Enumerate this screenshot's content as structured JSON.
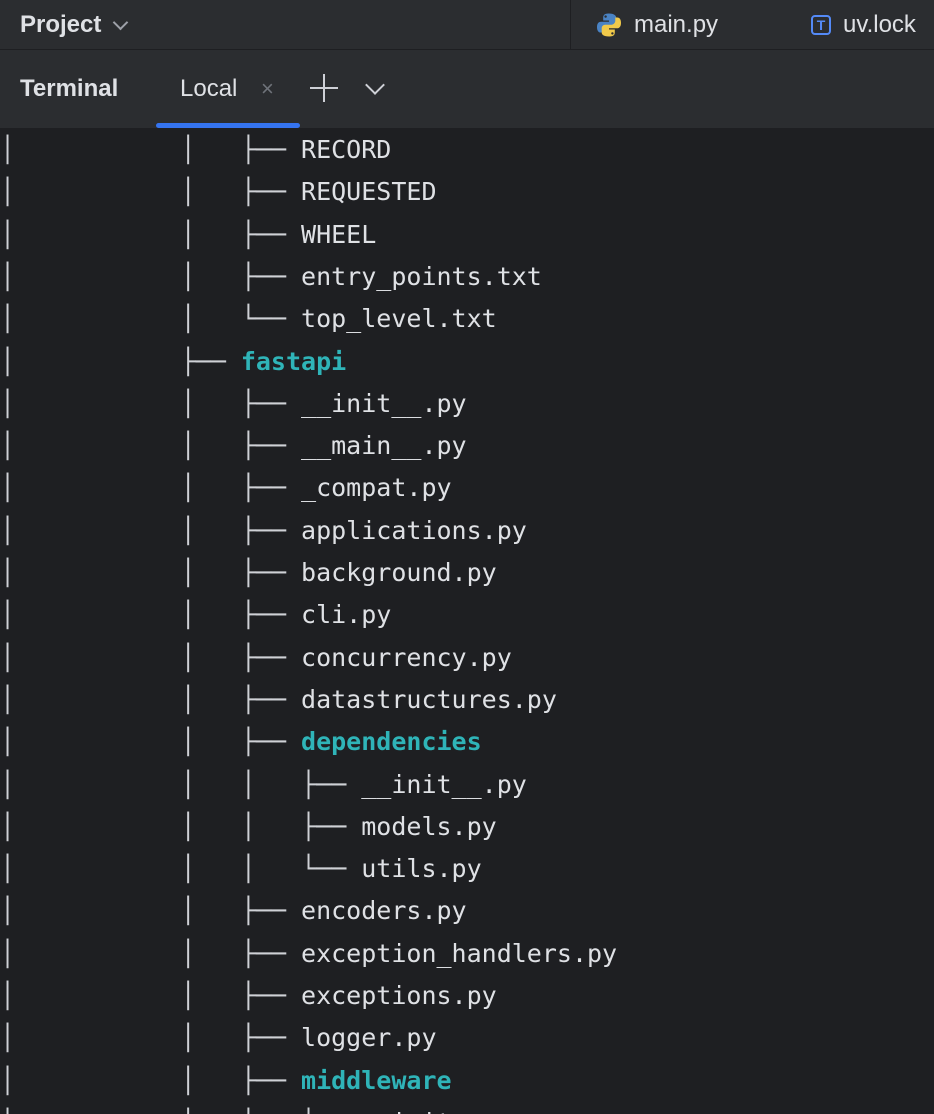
{
  "header": {
    "project_label": "Project",
    "tabs": [
      {
        "label": "main.py",
        "icon": "python-file-icon"
      },
      {
        "label": "uv.lock",
        "icon_letter": "T",
        "icon": "text-file-icon"
      }
    ]
  },
  "terminal_bar": {
    "title": "Terminal",
    "tab_label": "Local",
    "close_glyph": "×",
    "accent": "#3574f0"
  },
  "colors": {
    "background": "#1e1f22",
    "panel": "#2b2d30",
    "directory": "#2fb4b8",
    "text": "#dfe1e5"
  },
  "lines": [
    {
      "prefix": "│           │   ├── ",
      "text": "RECORD",
      "dir": false
    },
    {
      "prefix": "│           │   ├── ",
      "text": "REQUESTED",
      "dir": false
    },
    {
      "prefix": "│           │   ├── ",
      "text": "WHEEL",
      "dir": false
    },
    {
      "prefix": "│           │   ├── ",
      "text": "entry_points.txt",
      "dir": false
    },
    {
      "prefix": "│           │   └── ",
      "text": "top_level.txt",
      "dir": false
    },
    {
      "prefix": "│           ├── ",
      "text": "fastapi",
      "dir": true
    },
    {
      "prefix": "│           │   ├── ",
      "text": "__init__.py",
      "dir": false
    },
    {
      "prefix": "│           │   ├── ",
      "text": "__main__.py",
      "dir": false
    },
    {
      "prefix": "│           │   ├── ",
      "text": "_compat.py",
      "dir": false
    },
    {
      "prefix": "│           │   ├── ",
      "text": "applications.py",
      "dir": false
    },
    {
      "prefix": "│           │   ├── ",
      "text": "background.py",
      "dir": false
    },
    {
      "prefix": "│           │   ├── ",
      "text": "cli.py",
      "dir": false
    },
    {
      "prefix": "│           │   ├── ",
      "text": "concurrency.py",
      "dir": false
    },
    {
      "prefix": "│           │   ├── ",
      "text": "datastructures.py",
      "dir": false
    },
    {
      "prefix": "│           │   ├── ",
      "text": "dependencies",
      "dir": true
    },
    {
      "prefix": "│           │   │   ├── ",
      "text": "__init__.py",
      "dir": false
    },
    {
      "prefix": "│           │   │   ├── ",
      "text": "models.py",
      "dir": false
    },
    {
      "prefix": "│           │   │   └── ",
      "text": "utils.py",
      "dir": false
    },
    {
      "prefix": "│           │   ├── ",
      "text": "encoders.py",
      "dir": false
    },
    {
      "prefix": "│           │   ├── ",
      "text": "exception_handlers.py",
      "dir": false
    },
    {
      "prefix": "│           │   ├── ",
      "text": "exceptions.py",
      "dir": false
    },
    {
      "prefix": "│           │   ├── ",
      "text": "logger.py",
      "dir": false
    },
    {
      "prefix": "│           │   ├── ",
      "text": "middleware",
      "dir": true
    },
    {
      "prefix": "│           │   │   ├── ",
      "text": "__init__.py",
      "dir": false
    }
  ]
}
